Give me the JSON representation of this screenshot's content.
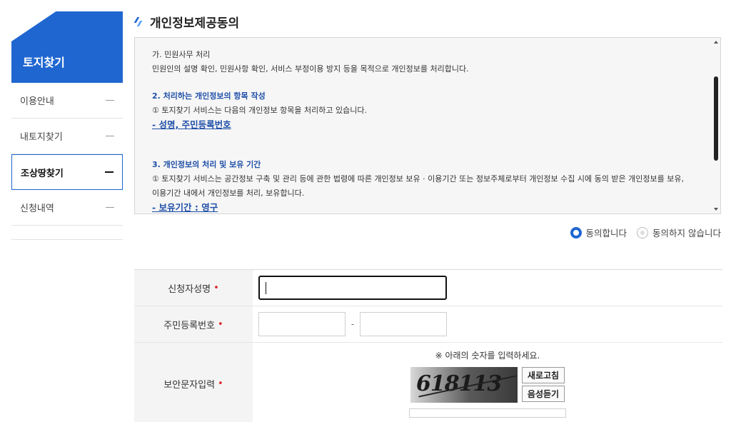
{
  "sidebar": {
    "title": "토지찾기",
    "items": [
      {
        "label": "이용안내"
      },
      {
        "label": "내토지찾기"
      },
      {
        "label": "조상땅찾기"
      },
      {
        "label": "신청내역"
      }
    ]
  },
  "section": {
    "title": "개인정보제공동의"
  },
  "terms": {
    "p1_title": "가. 민원사무 처리",
    "p1_body": "민원인의 설명 확인, 민원사항 확인, 서비스 부정이용 방지 등을 목적으로 개인정보를 처리합니다.",
    "p2_title": "2. 처리하는 개인정보의 항목 작성",
    "p2_body": "① 토지찾기 서비스는 다음의 개인정보 항목을 처리하고 있습니다.",
    "p2_items": "- 성명, 주민등록번호",
    "p3_title": "3. 개인정보의 처리 및 보유 기간",
    "p3_body1": "① 토지찾기 서비스는 공간정보 구축 및 관리 등에 관한 법령에 따른 개인정보 보유 · 이용기간 또는 정보주체로부터 개인정보 수집 시에 동의 받은 개인정보를 보유,",
    "p3_body2": "이용기간 내에서 개인정보를 처리, 보유합니다.",
    "p3_items": "- 보유기간 : 영구"
  },
  "agreement": {
    "agree_label": "동의합니다",
    "disagree_label": "동의하지 않습니다",
    "selected": "agree"
  },
  "form": {
    "name_label": "신청자성명",
    "id_label": "주민등록번호",
    "id_separator": "-",
    "captcha_label": "보안문자입력",
    "captcha_hint": "※ 아래의 숫자를 입력하세요.",
    "captcha_text": "618113",
    "refresh_button": "새로고침",
    "audio_button": "음성듣기",
    "required_mark": "•"
  },
  "colors": {
    "accent": "#1f66d1",
    "link": "#1f4fa8",
    "required": "#e0262f"
  }
}
